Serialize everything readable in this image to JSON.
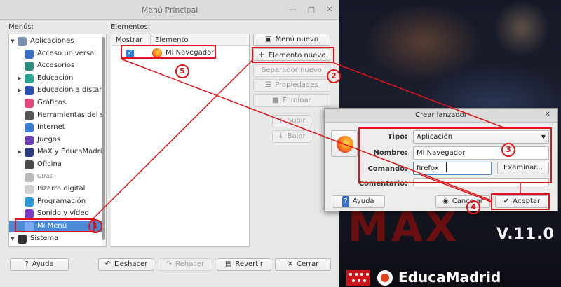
{
  "window": {
    "title": "Menú Principal"
  },
  "labels": {
    "menus": "Menús:",
    "elements": "Elementos:"
  },
  "tree": {
    "items": [
      {
        "label": "Aplicaciones",
        "level": 0,
        "expander": "down",
        "icon": "applications-icon",
        "color": "#7a8fb0"
      },
      {
        "label": "Acceso universal",
        "level": 1,
        "expander": "",
        "icon": "accessibility-icon",
        "color": "#3a6ec4"
      },
      {
        "label": "Accesorios",
        "level": 1,
        "expander": "",
        "icon": "accessories-icon",
        "color": "#2e8a7e"
      },
      {
        "label": "Educación",
        "level": 1,
        "expander": "right",
        "icon": "education-icon",
        "color": "#2aa58f"
      },
      {
        "label": "Educación a distanc",
        "level": 1,
        "expander": "right",
        "icon": "distance-education-icon",
        "color": "#2d4fb5"
      },
      {
        "label": "Gráficos",
        "level": 1,
        "expander": "",
        "icon": "graphics-icon",
        "color": "#e0487a"
      },
      {
        "label": "Herramientas del s",
        "level": 1,
        "expander": "",
        "icon": "system-tools-icon",
        "color": "#555555"
      },
      {
        "label": "Internet",
        "level": 1,
        "expander": "",
        "icon": "internet-icon",
        "color": "#3a7ad0"
      },
      {
        "label": "Juegos",
        "level": 1,
        "expander": "",
        "icon": "games-icon",
        "color": "#6a3fb0"
      },
      {
        "label": "MaX y EducaMadrid",
        "level": 1,
        "expander": "right",
        "icon": "max-icon",
        "color": "#2a3a7a"
      },
      {
        "label": "Oficina",
        "level": 1,
        "expander": "",
        "icon": "office-icon",
        "color": "#4a4a4a"
      },
      {
        "label": "Otras",
        "level": 1,
        "expander": "",
        "icon": "other-icon",
        "color": "#bbbbbb",
        "italic": true
      },
      {
        "label": "Pizarra digital",
        "level": 1,
        "expander": "",
        "icon": "whiteboard-icon",
        "color": "#cfcfcf"
      },
      {
        "label": "Programación",
        "level": 1,
        "expander": "",
        "icon": "programming-icon",
        "color": "#2b9ad6"
      },
      {
        "label": "Sonido y vídeo",
        "level": 1,
        "expander": "",
        "icon": "sound-video-icon",
        "color": "#7a3ac6"
      },
      {
        "label": "Mi Menú",
        "level": 1,
        "expander": "",
        "icon": "folder-icon",
        "color": "#7aaaf0",
        "selected": true
      },
      {
        "label": "Sistema",
        "level": 0,
        "expander": "down",
        "icon": "system-gear-icon",
        "color": "#333333"
      }
    ]
  },
  "elements_table": {
    "columns": [
      "Mostrar",
      "Elemento"
    ],
    "rows": [
      {
        "show": true,
        "name": "Mi Navegador",
        "icon": "firefox-icon"
      }
    ]
  },
  "side_buttons": {
    "new_menu": "Menú nuevo",
    "new_item": "Elemento nuevo",
    "new_separator": "Separador nuevo",
    "properties": "Propiedades",
    "delete": "Eliminar",
    "move_up": "Subir",
    "move_down": "Bajar"
  },
  "bottom_buttons": {
    "help": "Ayuda",
    "undo": "Deshacer",
    "redo": "Rehacer",
    "revert": "Revertir",
    "close": "Cerrar"
  },
  "dialog": {
    "title": "Crear lanzador",
    "type_label": "Tipo:",
    "type_value": "Aplicación",
    "name_label": "Nombre:",
    "name_value": "Mi Navegador",
    "command_label": "Comando:",
    "command_value": "firefox",
    "browse": "Examinar...",
    "comment_label": "Comentario:",
    "comment_value": "",
    "help": "Ayuda",
    "cancel": "Cancelar",
    "accept": "Aceptar"
  },
  "annotations": [
    "1",
    "2",
    "3",
    "4",
    "5"
  ],
  "desktop": {
    "logo": "MAX",
    "version": "V.11.0",
    "brand": "EducaMadrid"
  },
  "colors": {
    "annotation_red": "#e0141a",
    "selection_blue": "#4a8ad4"
  }
}
